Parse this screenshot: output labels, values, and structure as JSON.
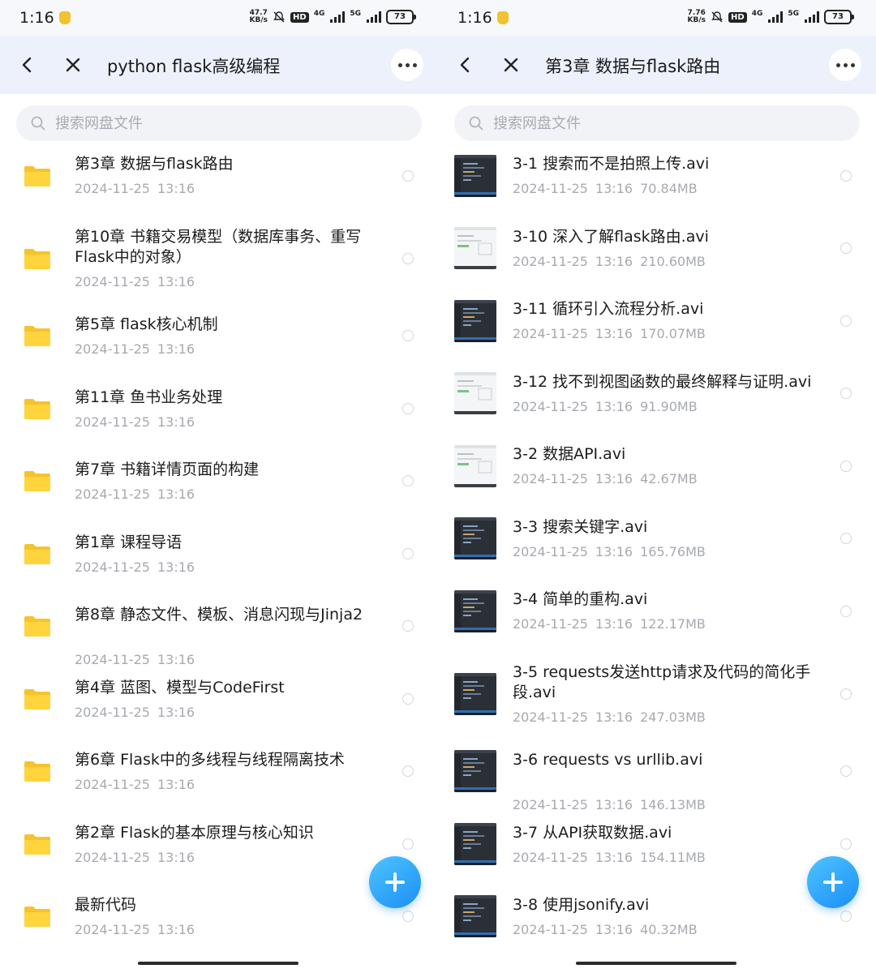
{
  "left": {
    "status": {
      "time": "1:16",
      "speed_value": "47.7",
      "speed_unit": "KB/s",
      "hd": "HD",
      "net1": "4G",
      "net2": "5G",
      "battery": "73"
    },
    "header": {
      "title": "python flask高级编程"
    },
    "search": {
      "placeholder": "搜索网盘文件"
    },
    "items": [
      {
        "name": "第3章 数据与flask路由",
        "date": "2024-11-25",
        "time": "13:16"
      },
      {
        "name": "第10章 书籍交易模型（数据库事务、重写Flask中的对象）",
        "date": "2024-11-25",
        "time": "13:16"
      },
      {
        "name": "第5章 flask核心机制",
        "date": "2024-11-25",
        "time": "13:16"
      },
      {
        "name": "第11章 鱼书业务处理",
        "date": "2024-11-25",
        "time": "13:16"
      },
      {
        "name": "第7章 书籍详情页面的构建",
        "date": "2024-11-25",
        "time": "13:16"
      },
      {
        "name": "第1章 课程导语",
        "date": "2024-11-25",
        "time": "13:16"
      },
      {
        "name": "第8章 静态文件、模板、消息闪现与Jinja2",
        "date": "2024-11-25",
        "time": "13:16"
      },
      {
        "name": "第4章 蓝图、模型与CodeFirst",
        "date": "2024-11-25",
        "time": "13:16"
      },
      {
        "name": "第6章 Flask中的多线程与线程隔离技术",
        "date": "2024-11-25",
        "time": "13:16"
      },
      {
        "name": "第2章 Flask的基本原理与核心知识",
        "date": "2024-11-25",
        "time": "13:16"
      },
      {
        "name": "最新代码",
        "date": "2024-11-25",
        "time": "13:16"
      }
    ]
  },
  "right": {
    "status": {
      "time": "1:16",
      "speed_value": "7.76",
      "speed_unit": "KB/s",
      "hd": "HD",
      "net1": "4G",
      "net2": "5G",
      "battery": "73"
    },
    "header": {
      "title": "第3章 数据与flask路由"
    },
    "search": {
      "placeholder": "搜索网盘文件"
    },
    "items": [
      {
        "name": "3-1 搜索而不是拍照上传.avi",
        "date": "2024-11-25",
        "time": "13:16",
        "size": "70.84MB",
        "thumb": "dark"
      },
      {
        "name": "3-10 深入了解flask路由.avi",
        "date": "2024-11-25",
        "time": "13:16",
        "size": "210.60MB",
        "thumb": "light"
      },
      {
        "name": "3-11 循环引入流程分析.avi",
        "date": "2024-11-25",
        "time": "13:16",
        "size": "170.07MB",
        "thumb": "dark"
      },
      {
        "name": "3-12 找不到视图函数的最终解释与证明.avi",
        "date": "2024-11-25",
        "time": "13:16",
        "size": "91.90MB",
        "thumb": "light"
      },
      {
        "name": "3-2 数据API.avi",
        "date": "2024-11-25",
        "time": "13:16",
        "size": "42.67MB",
        "thumb": "light"
      },
      {
        "name": "3-3 搜索关键字.avi",
        "date": "2024-11-25",
        "time": "13:16",
        "size": "165.76MB",
        "thumb": "dark"
      },
      {
        "name": "3-4 简单的重构.avi",
        "date": "2024-11-25",
        "time": "13:16",
        "size": "122.17MB",
        "thumb": "dark"
      },
      {
        "name": "3-5 requests发送http请求及代码的简化手段.avi",
        "date": "2024-11-25",
        "time": "13:16",
        "size": "247.03MB",
        "thumb": "dark"
      },
      {
        "name": "3-6 requests vs urllib.avi",
        "date": "2024-11-25",
        "time": "13:16",
        "size": "146.13MB",
        "thumb": "dark"
      },
      {
        "name": "3-7 从API获取数据.avi",
        "date": "2024-11-25",
        "time": "13:16",
        "size": "154.11MB",
        "thumb": "dark"
      },
      {
        "name": "3-8 使用jsonify.avi",
        "date": "2024-11-25",
        "time": "13:16",
        "size": "40.32MB",
        "thumb": "dark"
      }
    ]
  }
}
